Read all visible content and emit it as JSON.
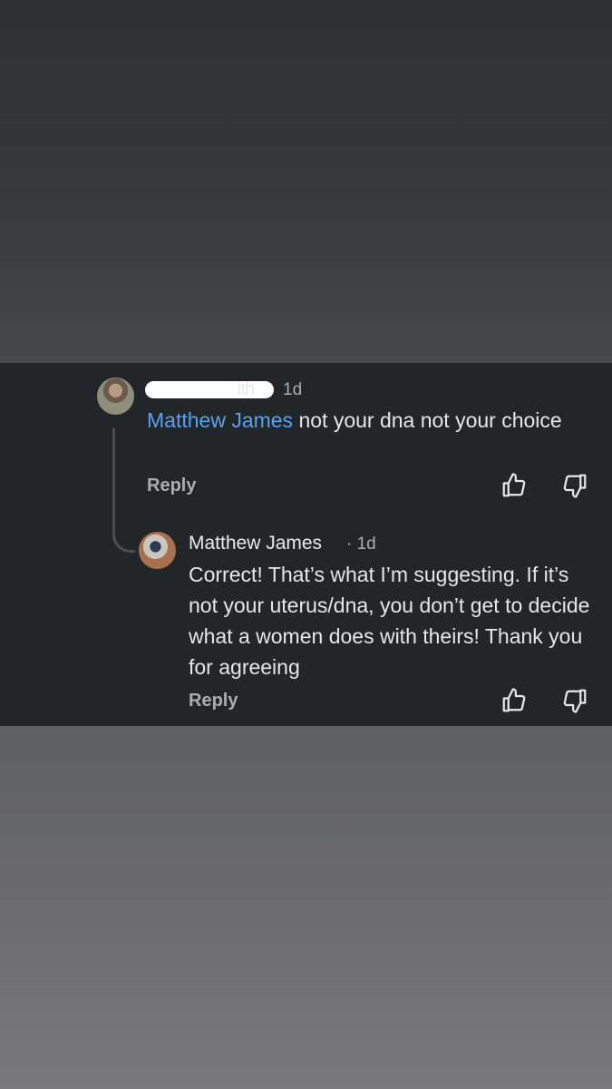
{
  "comments": [
    {
      "author": "",
      "time": "1d",
      "mention": "Matthew James",
      "text": " not your dna not your choice",
      "reply_label": "Reply"
    },
    {
      "author": "Matthew James",
      "time": "· 1d",
      "text": "Correct! That’s what I’m suggesting. If it’s not your uterus/dna, you don’t get to decide what a women does with theirs! Thank you for agreeing",
      "reply_label": "Reply"
    }
  ],
  "icons": {
    "like": "thumbs-up-icon",
    "dislike": "thumbs-down-icon"
  },
  "colors": {
    "band_background": "#232629",
    "mention": "#5aa0f2",
    "text": "#e6e6e7",
    "muted": "#a9acb0"
  }
}
